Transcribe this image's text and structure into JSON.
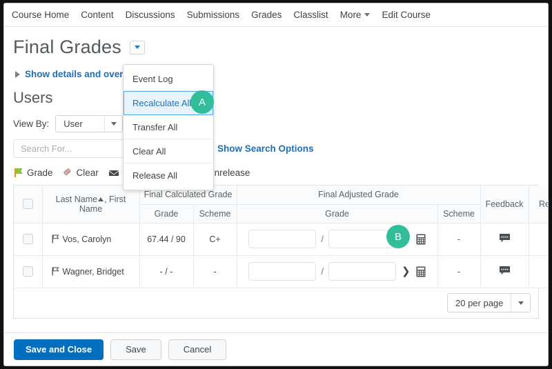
{
  "navbar": {
    "items": [
      {
        "label": "Course Home",
        "name": "nav-course-home"
      },
      {
        "label": "Content",
        "name": "nav-content"
      },
      {
        "label": "Discussions",
        "name": "nav-discussions"
      },
      {
        "label": "Submissions",
        "name": "nav-submissions"
      },
      {
        "label": "Grades",
        "name": "nav-grades"
      },
      {
        "label": "Classlist",
        "name": "nav-classlist"
      },
      {
        "label": "More",
        "name": "nav-more"
      },
      {
        "label": "Edit Course",
        "name": "nav-edit-course"
      }
    ]
  },
  "header": {
    "title": "Final Grades",
    "context_menu_icon": "chevron-down-icon"
  },
  "show_details": {
    "label": "Show details and overall ...",
    "expander_icon": "triangle-right-icon"
  },
  "dropdown_menu": {
    "items": [
      {
        "label": "Event Log",
        "selected": false
      },
      {
        "label": "Recalculate All",
        "selected": true
      },
      {
        "label": "Transfer All",
        "selected": false
      },
      {
        "label": "Clear All",
        "selected": false
      },
      {
        "label": "Release All",
        "selected": false
      }
    ]
  },
  "users_section": {
    "heading": "Users",
    "view_by_label": "View By:",
    "view_by_value": "User",
    "view_by_options": [
      "User"
    ],
    "search_placeholder": "Search For...",
    "search_value": "",
    "search_options_link": "Show Search Options"
  },
  "toolbar": {
    "actions": [
      {
        "label": "Grade",
        "icon": "grade-flag-icon",
        "name": "grade-action"
      },
      {
        "label": "Clear",
        "icon": "eraser-icon",
        "name": "clear-action"
      },
      {
        "label": "Email",
        "icon": "envelope-icon",
        "name": "email-action"
      },
      {
        "label": "Release/Unrelease",
        "icon": "person-release-icon",
        "name": "release-unrelease-action"
      }
    ]
  },
  "table": {
    "group_headers": {
      "final_calculated_grade": "Final Calculated Grade",
      "final_adjusted_grade": "Final Adjusted Grade"
    },
    "columns": {
      "select_all": "",
      "name": "Last Name",
      "name_suffix": ", First Name",
      "sort_icon": "sort-ascending-icon",
      "calc_grade": "Grade",
      "calc_scheme": "Scheme",
      "adj_grade": "Grade",
      "adj_scheme": "Scheme",
      "feedback": "Feedback",
      "released": "Re"
    },
    "rows": [
      {
        "name": "Vos, Carolyn",
        "flag_icon": "flag-icon",
        "calc_grade": "67.44 / 90",
        "calc_scheme": "C+",
        "adj_numerator": "",
        "adj_denominator": "",
        "adj_separator": "/",
        "arrow_icon": "chevron-right-icon",
        "calculator_icon": "calculator-icon",
        "adj_scheme": "-",
        "feedback_icon": "feedback-bubble-icon"
      },
      {
        "name": "Wagner, Bridget",
        "flag_icon": "flag-icon",
        "calc_grade": "- / -",
        "calc_scheme": "-",
        "adj_numerator": "",
        "adj_denominator": "",
        "adj_separator": "/",
        "arrow_icon": "chevron-right-icon",
        "calculator_icon": "calculator-icon",
        "adj_scheme": "-",
        "feedback_icon": "feedback-bubble-icon"
      }
    ]
  },
  "paging": {
    "per_page_value": "20 per page",
    "per_page_options": [
      "20 per page"
    ]
  },
  "footer": {
    "save_and_close": "Save and Close",
    "save": "Save",
    "cancel": "Cancel"
  },
  "annotations": [
    {
      "label": "A",
      "target": "recalculate-all-menu-item"
    },
    {
      "label": "B",
      "target": "final-adjusted-grade-column"
    }
  ],
  "colors": {
    "accent_blue": "#006fbf",
    "link_blue": "#1c6fb8",
    "badge_teal": "#32bd9b",
    "selected_menu_bg": "#e8f4fd",
    "selected_menu_border": "#51a7e8"
  }
}
